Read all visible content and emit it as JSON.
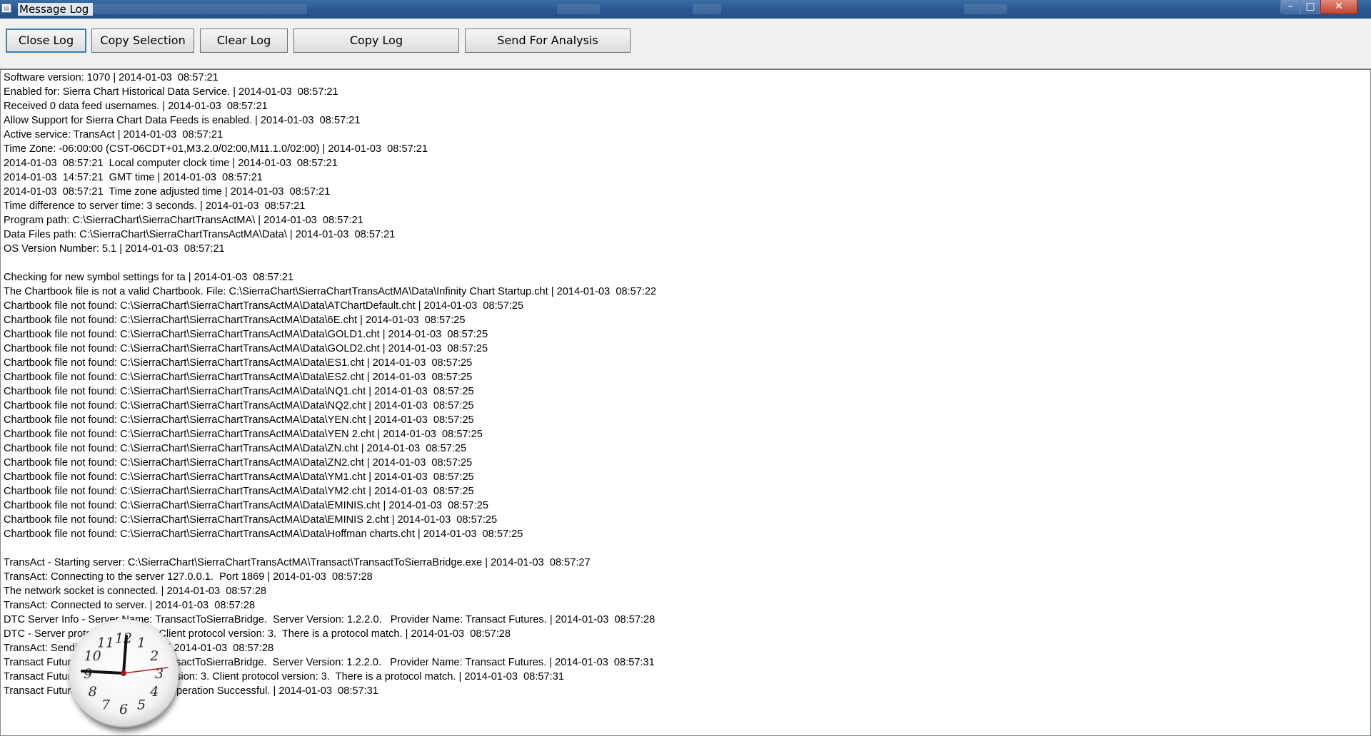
{
  "window": {
    "title": "Message Log"
  },
  "titlebar_buttons": {
    "minimize": "–",
    "maximize": "□",
    "close": "✕"
  },
  "toolbar": {
    "close_log": "Close Log",
    "copy_selection": "Copy Selection",
    "clear_log": "Clear Log",
    "copy_log": "Copy Log",
    "send_for_analysis": "Send For Analysis"
  },
  "log": {
    "lines": [
      "Software version: 1070 | 2014-01-03  08:57:21",
      "Enabled for: Sierra Chart Historical Data Service. | 2014-01-03  08:57:21",
      "Received 0 data feed usernames. | 2014-01-03  08:57:21",
      "Allow Support for Sierra Chart Data Feeds is enabled. | 2014-01-03  08:57:21",
      "Active service: TransAct | 2014-01-03  08:57:21",
      "Time Zone: -06:00:00 (CST-06CDT+01,M3.2.0/02:00,M11.1.0/02:00) | 2014-01-03  08:57:21",
      "2014-01-03  08:57:21  Local computer clock time | 2014-01-03  08:57:21",
      "2014-01-03  14:57:21  GMT time | 2014-01-03  08:57:21",
      "2014-01-03  08:57:21  Time zone adjusted time | 2014-01-03  08:57:21",
      "Time difference to server time: 3 seconds. | 2014-01-03  08:57:21",
      "Program path: C:\\SierraChart\\SierraChartTransActMA\\ | 2014-01-03  08:57:21",
      "Data Files path: C:\\SierraChart\\SierraChartTransActMA\\Data\\ | 2014-01-03  08:57:21",
      "OS Version Number: 5.1 | 2014-01-03  08:57:21",
      "",
      "Checking for new symbol settings for ta | 2014-01-03  08:57:21",
      "The Chartbook file is not a valid Chartbook. File: C:\\SierraChart\\SierraChartTransActMA\\Data\\Infinity Chart Startup.cht | 2014-01-03  08:57:22",
      "Chartbook file not found: C:\\SierraChart\\SierraChartTransActMA\\Data\\ATChartDefault.cht | 2014-01-03  08:57:25",
      "Chartbook file not found: C:\\SierraChart\\SierraChartTransActMA\\Data\\6E.cht | 2014-01-03  08:57:25",
      "Chartbook file not found: C:\\SierraChart\\SierraChartTransActMA\\Data\\GOLD1.cht | 2014-01-03  08:57:25",
      "Chartbook file not found: C:\\SierraChart\\SierraChartTransActMA\\Data\\GOLD2.cht | 2014-01-03  08:57:25",
      "Chartbook file not found: C:\\SierraChart\\SierraChartTransActMA\\Data\\ES1.cht | 2014-01-03  08:57:25",
      "Chartbook file not found: C:\\SierraChart\\SierraChartTransActMA\\Data\\ES2.cht | 2014-01-03  08:57:25",
      "Chartbook file not found: C:\\SierraChart\\SierraChartTransActMA\\Data\\NQ1.cht | 2014-01-03  08:57:25",
      "Chartbook file not found: C:\\SierraChart\\SierraChartTransActMA\\Data\\NQ2.cht | 2014-01-03  08:57:25",
      "Chartbook file not found: C:\\SierraChart\\SierraChartTransActMA\\Data\\YEN.cht | 2014-01-03  08:57:25",
      "Chartbook file not found: C:\\SierraChart\\SierraChartTransActMA\\Data\\YEN 2.cht | 2014-01-03  08:57:25",
      "Chartbook file not found: C:\\SierraChart\\SierraChartTransActMA\\Data\\ZN.cht | 2014-01-03  08:57:25",
      "Chartbook file not found: C:\\SierraChart\\SierraChartTransActMA\\Data\\ZN2.cht | 2014-01-03  08:57:25",
      "Chartbook file not found: C:\\SierraChart\\SierraChartTransActMA\\Data\\YM1.cht | 2014-01-03  08:57:25",
      "Chartbook file not found: C:\\SierraChart\\SierraChartTransActMA\\Data\\YM2.cht | 2014-01-03  08:57:25",
      "Chartbook file not found: C:\\SierraChart\\SierraChartTransActMA\\Data\\EMINIS.cht | 2014-01-03  08:57:25",
      "Chartbook file not found: C:\\SierraChart\\SierraChartTransActMA\\Data\\EMINIS 2.cht | 2014-01-03  08:57:25",
      "Chartbook file not found: C:\\SierraChart\\SierraChartTransActMA\\Data\\Hoffman charts.cht | 2014-01-03  08:57:25",
      "",
      "TransAct - Starting server: C:\\SierraChart\\SierraChartTransActMA\\Transact\\TransactToSierraBridge.exe | 2014-01-03  08:57:27",
      "TransAct: Connecting to the server 127.0.0.1.  Port 1869 | 2014-01-03  08:57:28",
      "The network socket is connected. | 2014-01-03  08:57:28",
      "TransAct: Connected to server. | 2014-01-03  08:57:28",
      "DTC Server Info - Server Name: TransactToSierraBridge.  Server Version: 1.2.2.0.   Provider Name: Transact Futures. | 2014-01-03  08:57:28",
      "DTC - Server protocol version: 3. Client protocol version: 3.  There is a protocol match. | 2014-01-03  08:57:28",
      "TransAct: Sending logon message. | 2014-01-03  08:57:28",
      "Transact Futures: Server Name: TransactToSierraBridge.  Server Version: 1.2.2.0.   Provider Name: Transact Futures. | 2014-01-03  08:57:31",
      "Transact Futures: Server protocol version: 3. Client protocol version: 3.  There is a protocol match. | 2014-01-03  08:57:31",
      "Transact Futures: Logon Accepted. Operation Successful. | 2014-01-03  08:57:31"
    ]
  },
  "clock_gadget": {
    "numerals": [
      "12",
      "1",
      "2",
      "3",
      "4",
      "5",
      "6",
      "7",
      "8",
      "9",
      "10",
      "11"
    ]
  }
}
